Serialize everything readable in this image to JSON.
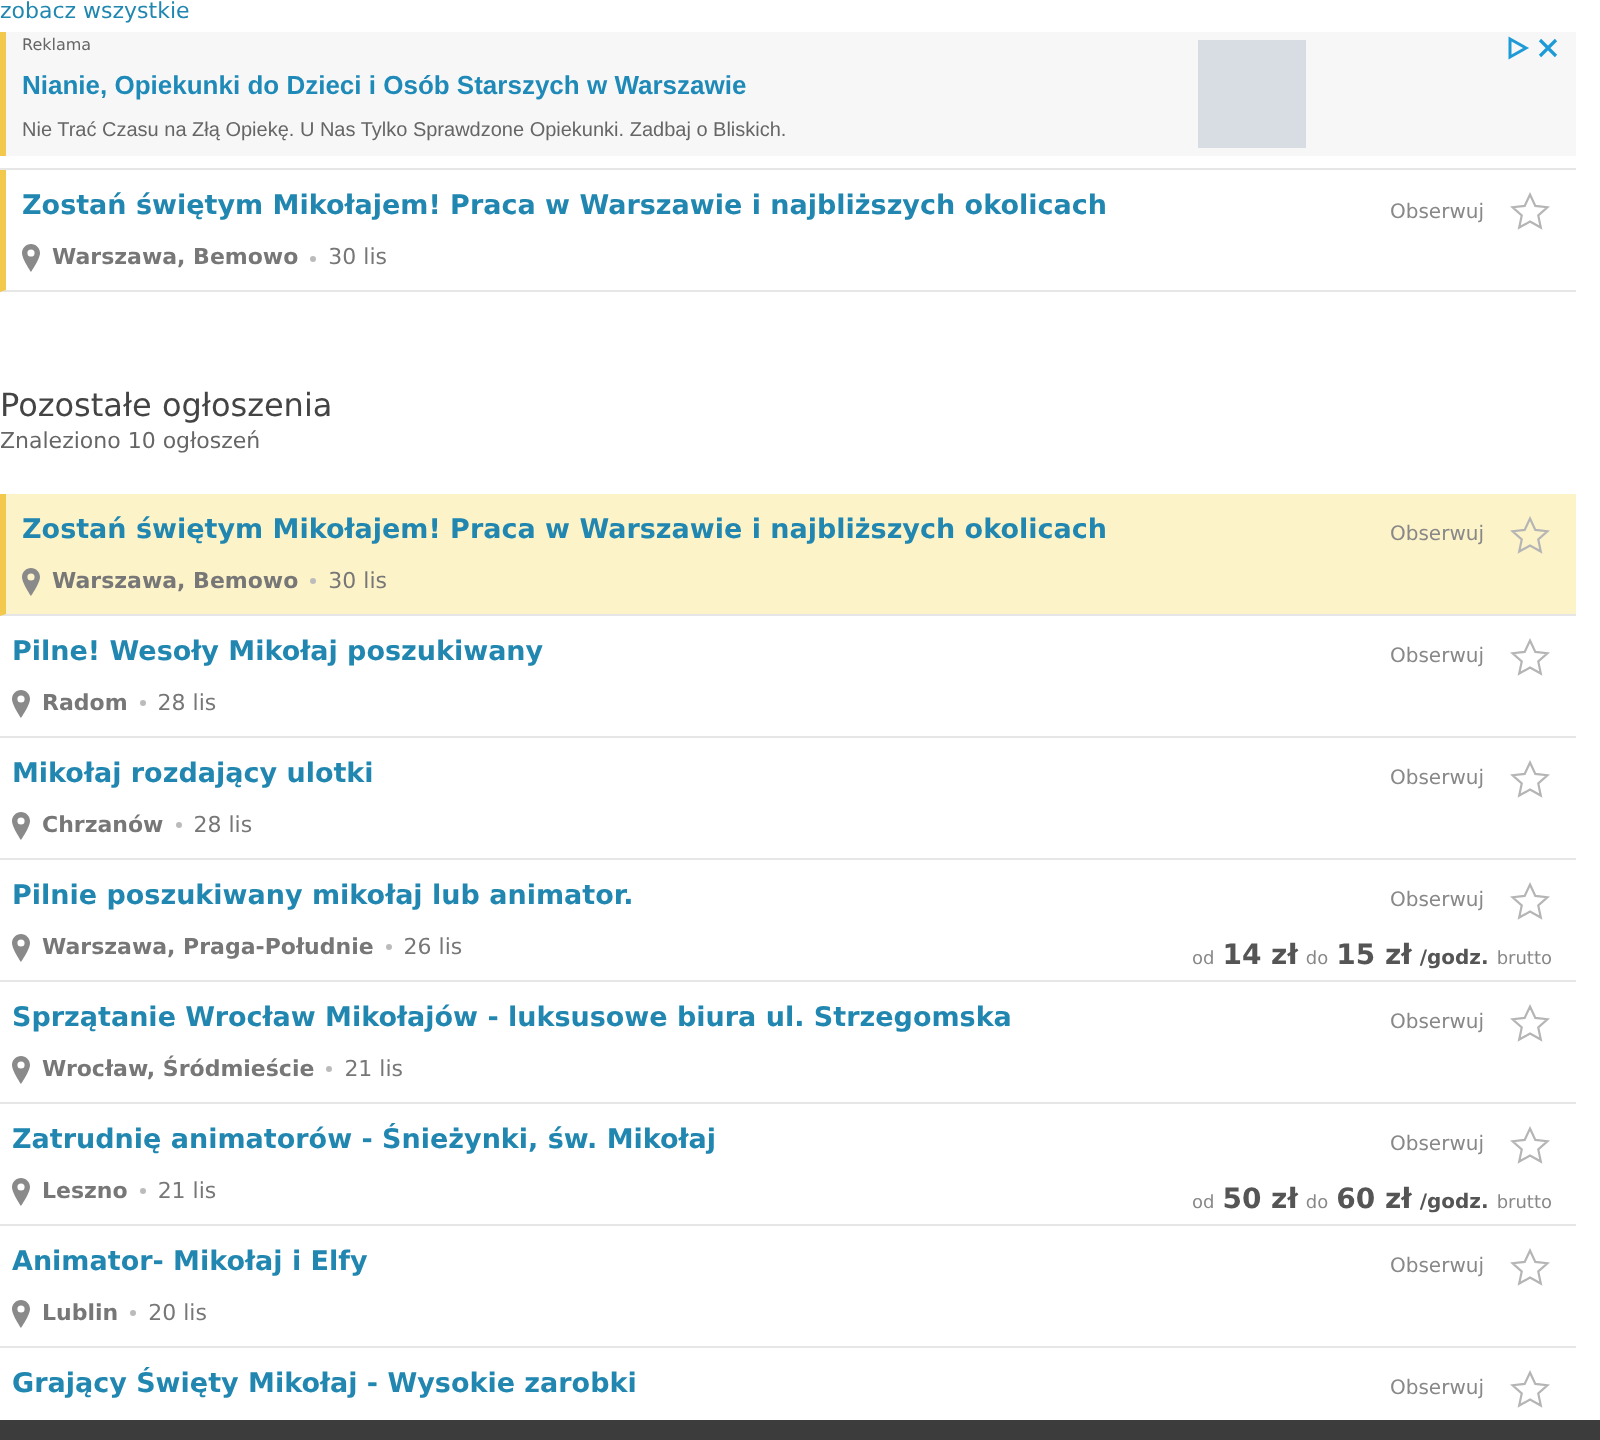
{
  "see_all_link": "zobacz wszystkie",
  "ad": {
    "label": "Reklama",
    "title": "Nianie, Opiekunki do Dzieci i Osób Starszych w Warszawie",
    "description": "Nie Trać Czasu na Złą Opiekę. U Nas Tylko Sprawdzone Opiekunki. Zadbaj o Bliskich."
  },
  "promoted": {
    "title": "Zostań świętym Mikołajem! Praca w Warszawie i najbliższych okolicach",
    "location": "Warszawa, Bemowo",
    "date": "30 lis",
    "follow": "Obserwuj",
    "starred": false
  },
  "section": {
    "title": "Pozostałe ogłoszenia",
    "count": "Znaleziono 10 ogłoszeń"
  },
  "listings": [
    {
      "title": "Zostań świętym Mikołajem! Praca w Warszawie i najbliższych okolicach",
      "location": "Warszawa, Bemowo",
      "date": "30 lis",
      "follow": "Obserwuj",
      "starred": false,
      "highlighted": true
    },
    {
      "title": "Pilne! Wesoły Mikołaj poszukiwany",
      "location": "Radom",
      "date": "28 lis",
      "follow": "Obserwuj",
      "starred": false,
      "highlighted": false
    },
    {
      "title": "Mikołaj rozdający ulotki",
      "location": "Chrzanów",
      "date": "28 lis",
      "follow": "Obserwuj",
      "starred": false,
      "highlighted": false
    },
    {
      "title": "Pilnie poszukiwany mikołaj lub animator.",
      "location": "Warszawa, Praga-Południe",
      "date": "26 lis",
      "follow": "Obserwuj",
      "starred": false,
      "highlighted": false,
      "salary": {
        "from_label": "od",
        "from": "14 zł",
        "to_label": "do",
        "to": "15 zł",
        "unit": "/godz.",
        "note": "brutto"
      }
    },
    {
      "title": "Sprzątanie Wrocław Mikołajów - luksusowe biura ul. Strzegomska",
      "location": "Wrocław, Śródmieście",
      "date": "21 lis",
      "follow": "Obserwuj",
      "starred": false,
      "highlighted": false
    },
    {
      "title": "Zatrudnię animatorów - Śnieżynki, św. Mikołaj",
      "location": "Leszno",
      "date": "21 lis",
      "follow": "Obserwuj",
      "starred": false,
      "highlighted": false,
      "salary": {
        "from_label": "od",
        "from": "50 zł",
        "to_label": "do",
        "to": "60 zł",
        "unit": "/godz.",
        "note": "brutto"
      }
    },
    {
      "title": "Animator- Mikołaj i Elfy",
      "location": "Lublin",
      "date": "20 lis",
      "follow": "Obserwuj",
      "starred": false,
      "highlighted": false
    },
    {
      "title": "Grający Święty Mikołaj - Wysokie zarobki",
      "follow": "Obserwuj",
      "starred": false,
      "highlighted": false
    }
  ]
}
